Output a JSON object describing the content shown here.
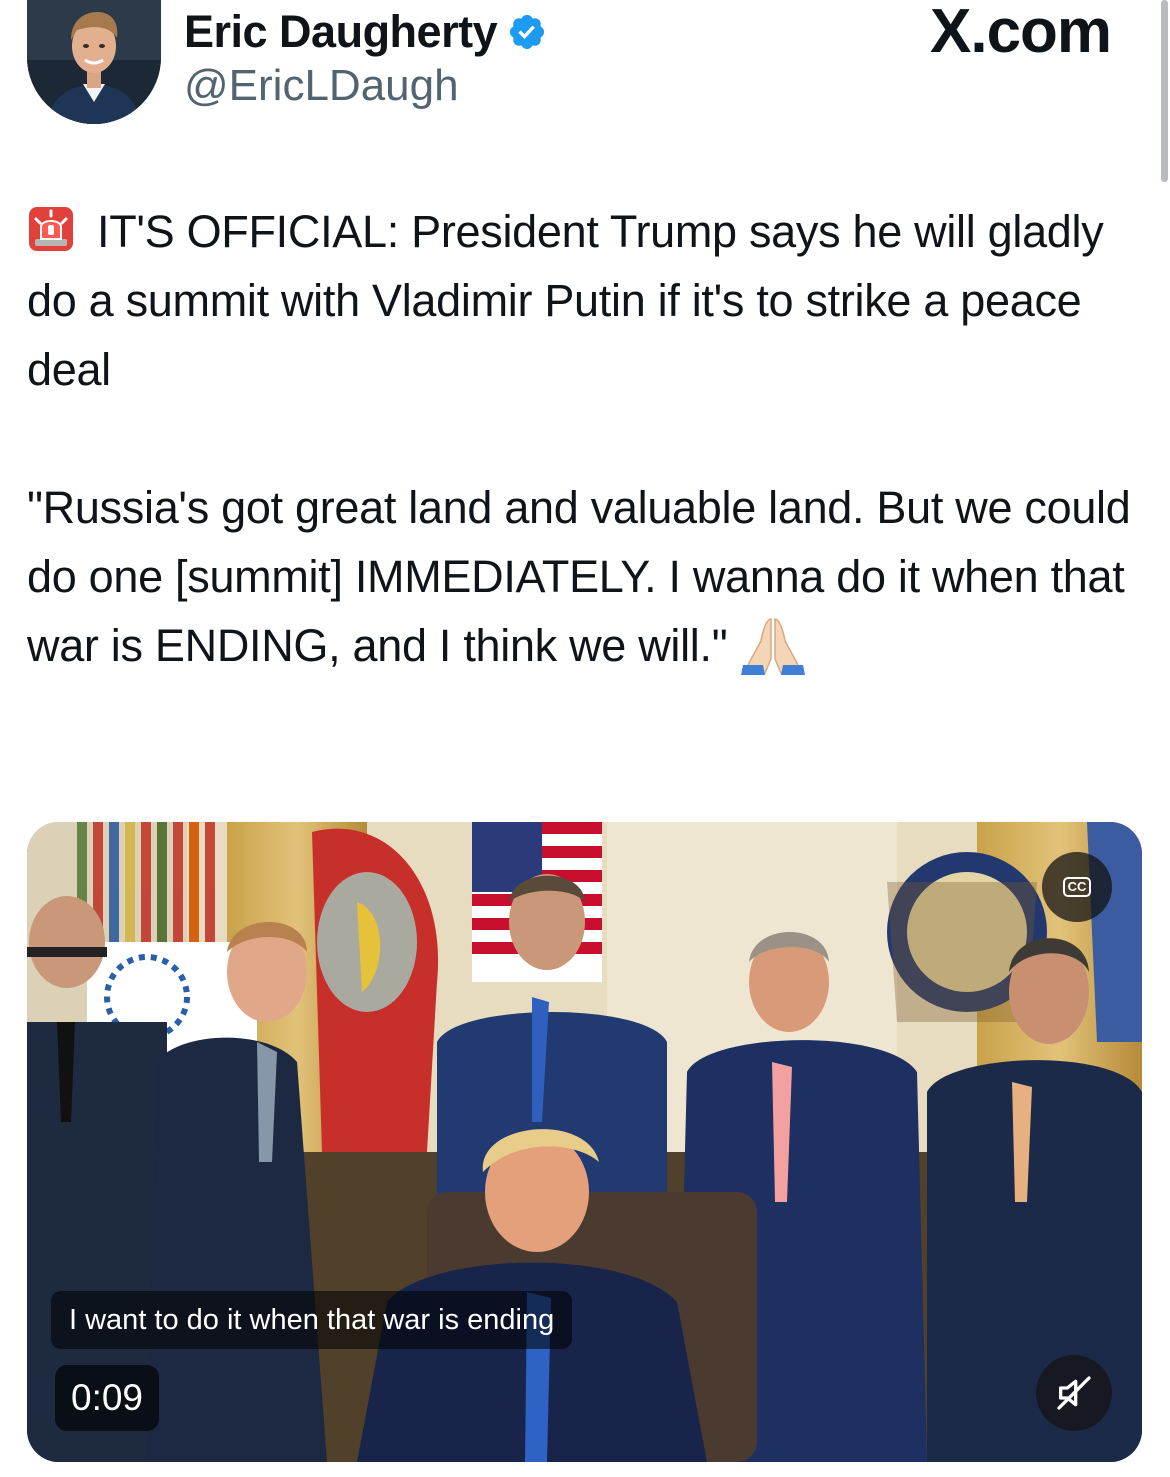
{
  "author": {
    "display_name": "Eric Daugherty",
    "handle": "@EricLDaugh",
    "verified": true
  },
  "watermark": "X.com",
  "tweet": {
    "paragraph1": "IT'S OFFICIAL: President Trump says he will gladly do a summit with Vladimir Putin if it's to strike a peace deal",
    "paragraph2": "\"Russia's got great land and valuable land. But we could do one [summit] IMMEDIATELY. I wanna do it when that war is ENDING, and I think we will.\"",
    "leading_emoji": "siren-icon",
    "trailing_emoji": "folded-hands-icon"
  },
  "video": {
    "caption": "I want to do it when that war is ending",
    "timestamp": "0:09",
    "cc_label": "CC",
    "muted": true
  },
  "colors": {
    "verified_blue": "#1d9bf0",
    "handle_gray": "#536471",
    "text": "#0f1419"
  }
}
